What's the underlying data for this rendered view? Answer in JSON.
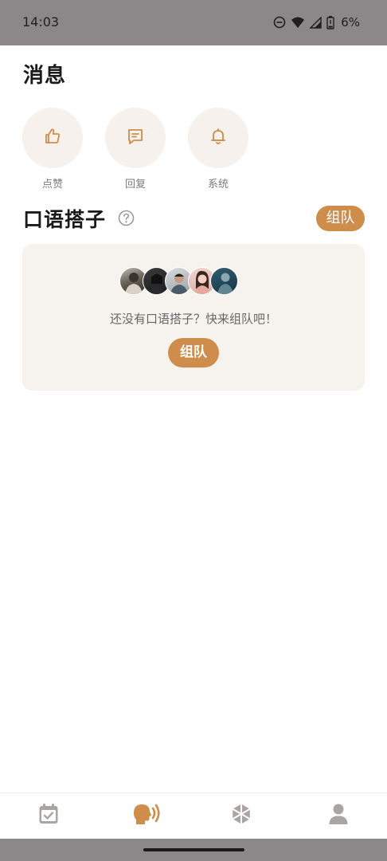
{
  "status_bar": {
    "time": "14:03",
    "battery_percent": "6%"
  },
  "header": {
    "title": "消息"
  },
  "quick_actions": [
    {
      "label": "点赞",
      "icon": "thumbs-up-icon"
    },
    {
      "label": "回复",
      "icon": "message-icon"
    },
    {
      "label": "系统",
      "icon": "bell-icon"
    }
  ],
  "speaking_partners": {
    "title": "口语搭子",
    "team_button_label": "组队",
    "empty_message": "还没有口语搭子？快来组队吧！",
    "card_button_label": "组队",
    "avatar_count": 5
  },
  "bottom_nav": {
    "items": [
      {
        "icon": "calendar-check-icon",
        "active": false
      },
      {
        "icon": "speaking-head-icon",
        "active": true
      },
      {
        "icon": "explore-icon",
        "active": false
      },
      {
        "icon": "profile-icon",
        "active": false
      }
    ]
  },
  "colors": {
    "accent": "#cf8d4c",
    "circle_bg": "#f6f1ec",
    "card_bg": "#f6f3ee",
    "inactive_icon": "#a9a5a2",
    "status_bar_bg": "#8c8788"
  }
}
